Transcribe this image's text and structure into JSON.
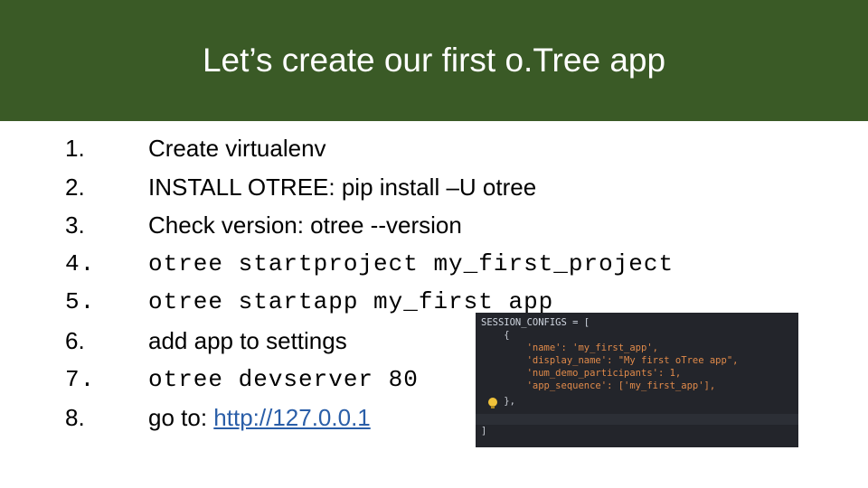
{
  "slide": {
    "title": "Let’s create our first o.Tree app"
  },
  "steps": [
    {
      "number": "1.",
      "text": "Create virtualenv"
    },
    {
      "number": "2.",
      "text": "INSTALL OTREE: pip install –U otree"
    },
    {
      "number": "3.",
      "text": "Check version: otree --version"
    },
    {
      "number": "4.",
      "text": "otree startproject my_first_project"
    },
    {
      "number": "5.",
      "text": "otree startapp my_first app"
    },
    {
      "number": "6.",
      "text": "add app to settings"
    },
    {
      "number": "7.",
      "text": "otree devserver 80"
    },
    {
      "number": "8.",
      "text_prefix": "go to: ",
      "link": "http://127.0.0.1"
    }
  ],
  "code_snippet": {
    "lines": [
      "SESSION_CONFIGS = [",
      "    {",
      "        'name': 'my_first_app',",
      "        'display_name': \"My first oTree app\",",
      "        'num_demo_participants': 1,",
      "        'app_sequence': ['my_first_app'],",
      "    },",
      "]"
    ]
  },
  "colors": {
    "header_bg": "#3a5a26",
    "link": "#2a5ea8",
    "code_bg": "#23252b"
  }
}
